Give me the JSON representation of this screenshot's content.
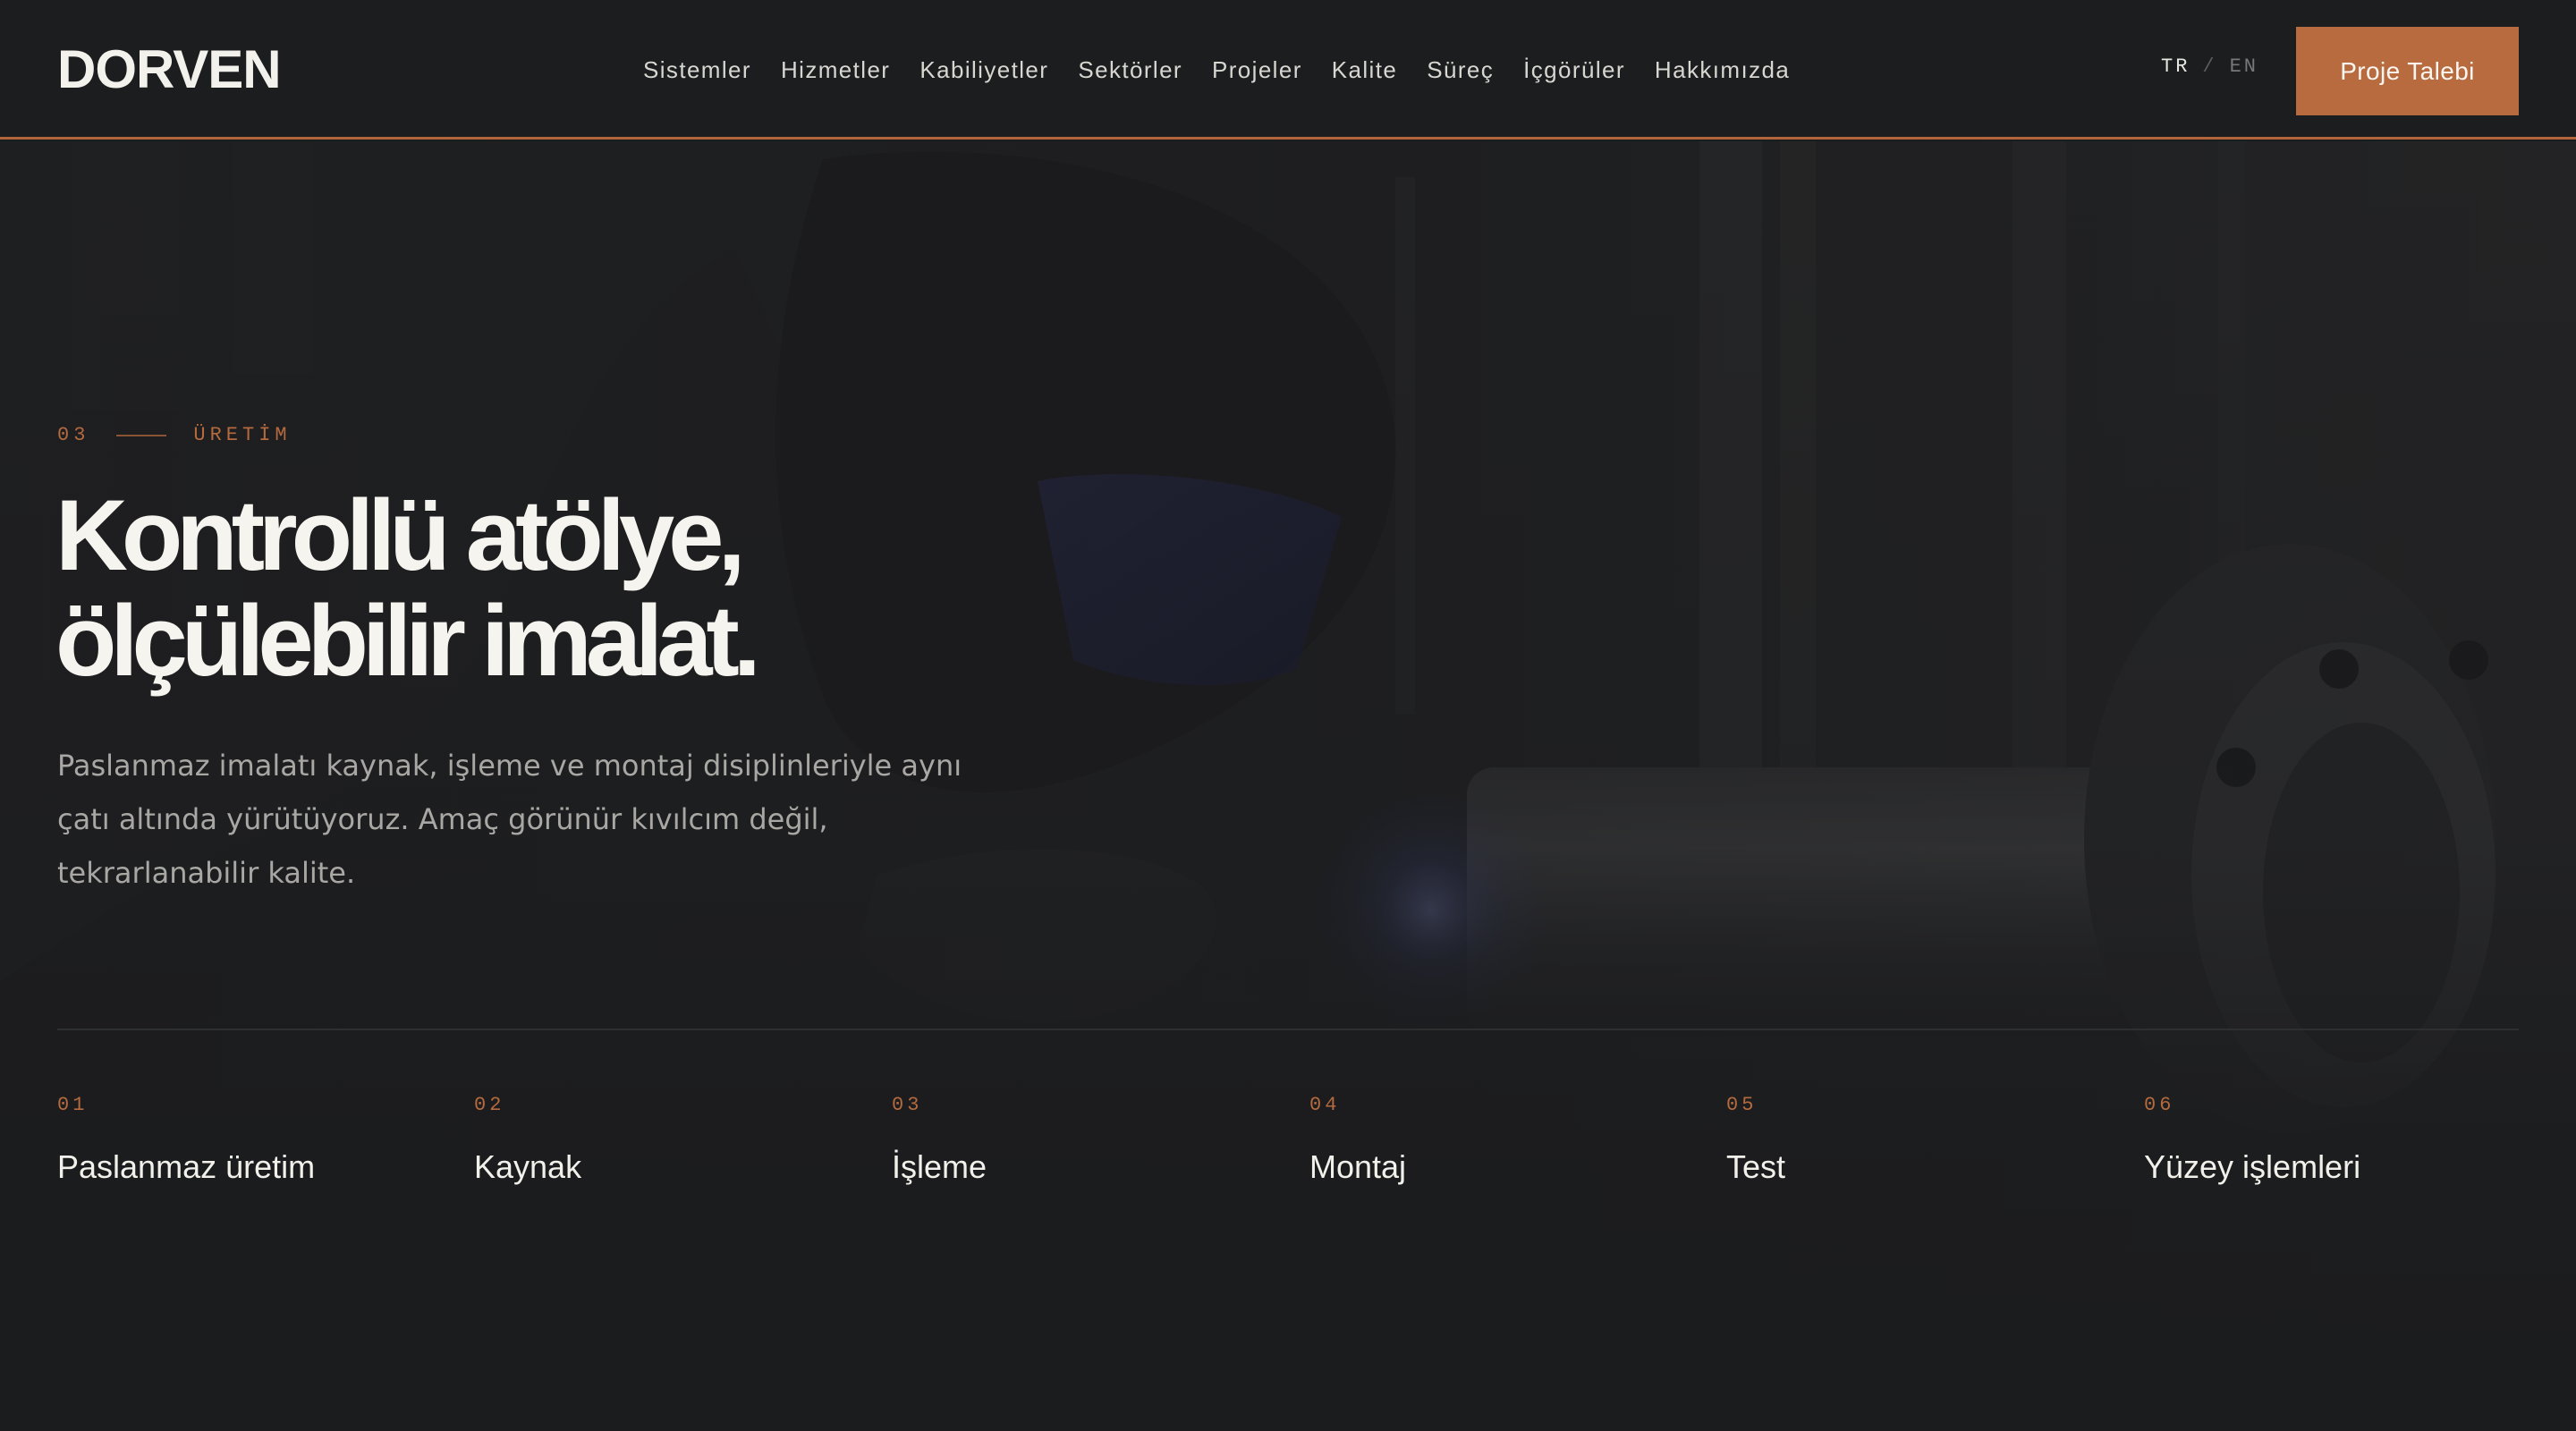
{
  "brand": {
    "logo_text": "DORVEN",
    "accent_color": "#b76b3e"
  },
  "nav": {
    "items": [
      {
        "label": "Sistemler"
      },
      {
        "label": "Hizmetler"
      },
      {
        "label": "Kabiliyetler"
      },
      {
        "label": "Sektörler"
      },
      {
        "label": "Projeler"
      },
      {
        "label": "Kalite"
      },
      {
        "label": "Süreç"
      },
      {
        "label": "İçgörüler"
      },
      {
        "label": "Hakkımızda"
      }
    ]
  },
  "lang": {
    "current": "TR",
    "separator": "/",
    "other": "EN"
  },
  "cta": {
    "label": "Proje Talebi"
  },
  "hero": {
    "eyebrow_number": "03",
    "eyebrow_label": "ÜRETİM",
    "headline_line1": "Kontrollü atölye,",
    "headline_line2": "ölçülebilir imalat.",
    "lede": "Paslanmaz imalatı kaynak, işleme ve montaj disiplinleriyle aynı çatı altında yürütüyoruz. Amaç görünür kıvılcım değil, tekrarlanabilir kalite."
  },
  "capabilities": [
    {
      "number": "01",
      "label": "Paslanmaz üretim"
    },
    {
      "number": "02",
      "label": "Kaynak"
    },
    {
      "number": "03",
      "label": "İşleme"
    },
    {
      "number": "04",
      "label": "Montaj"
    },
    {
      "number": "05",
      "label": "Test"
    },
    {
      "number": "06",
      "label": "Yüzey işlemleri"
    }
  ]
}
